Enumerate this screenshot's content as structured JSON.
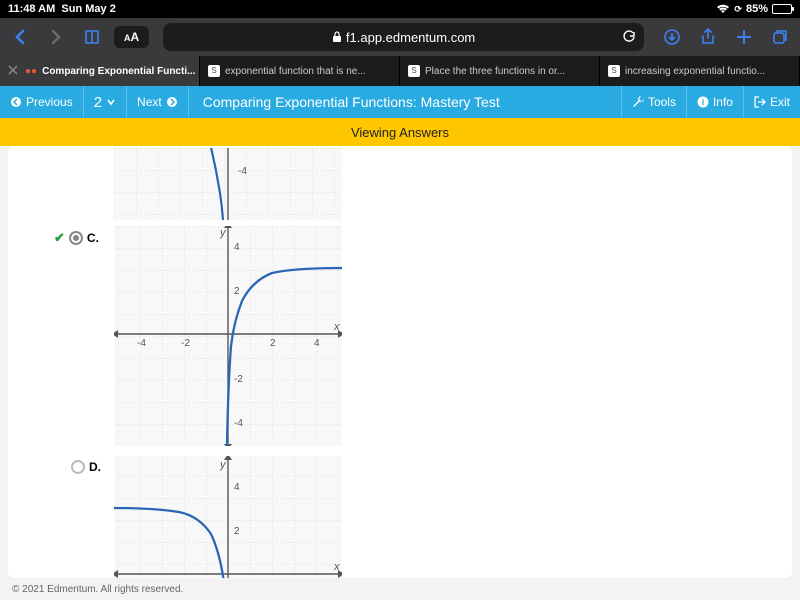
{
  "status": {
    "time": "11:48 AM",
    "date": "Sun May 2",
    "battery": "85%"
  },
  "browser": {
    "url_host": "f1.app.edmentum.com",
    "tabs": [
      {
        "title": "Comparing Exponential Functi..."
      },
      {
        "title": "exponential function that is ne..."
      },
      {
        "title": "Place the three functions in or..."
      },
      {
        "title": "increasing exponential functio..."
      }
    ]
  },
  "appbar": {
    "previous": "Previous",
    "next": "Next",
    "question_number": "2",
    "title": "Comparing Exponential Functions: Mastery Test",
    "tools": "Tools",
    "info": "Info",
    "exit": "Exit"
  },
  "banner": "Viewing Answers",
  "options": {
    "c": {
      "label": "C.",
      "correct": true
    },
    "d": {
      "label": "D.",
      "correct": false
    }
  },
  "chart_data": [
    {
      "type": "line",
      "note": "partial view bottom of option B",
      "xlim": [
        -5,
        5
      ],
      "ylim": [
        -6,
        -3
      ],
      "axis_ticks_y": [
        -4
      ],
      "series": [
        {
          "name": "curve",
          "color": "#1f5eae",
          "points": [
            [
              -0.9,
              -3.2
            ],
            [
              -0.6,
              -4
            ],
            [
              -0.4,
              -5
            ],
            [
              -0.2,
              -6
            ]
          ]
        }
      ]
    },
    {
      "type": "line",
      "title": "",
      "xlabel": "x",
      "ylabel": "y",
      "xlim": [
        -5,
        5
      ],
      "ylim": [
        -6,
        5
      ],
      "axis_ticks_x": [
        -4,
        -2,
        2,
        4
      ],
      "axis_ticks_y": [
        -4,
        -2,
        2,
        4
      ],
      "series": [
        {
          "name": "curve",
          "color": "#1f5eae",
          "points": [
            [
              -0.08,
              -6
            ],
            [
              -0.03,
              -4
            ],
            [
              0.05,
              -2
            ],
            [
              0.15,
              -0.5
            ],
            [
              0.35,
              0.8
            ],
            [
              0.7,
              1.8
            ],
            [
              1.1,
              2.3
            ],
            [
              1.6,
              2.6
            ],
            [
              2.5,
              2.85
            ],
            [
              3.5,
              2.95
            ],
            [
              5,
              3.0
            ]
          ]
        }
      ]
    },
    {
      "type": "line",
      "title": "",
      "xlabel": "x",
      "ylabel": "y",
      "xlim": [
        -5,
        5
      ],
      "ylim": [
        0,
        5
      ],
      "axis_ticks_y": [
        2,
        4
      ],
      "series": [
        {
          "name": "curve",
          "color": "#1f5eae",
          "points": [
            [
              -5,
              3.0
            ],
            [
              -3.5,
              2.95
            ],
            [
              -2.5,
              2.85
            ],
            [
              -1.6,
              2.6
            ],
            [
              -1.1,
              2.3
            ],
            [
              -0.7,
              1.8
            ],
            [
              -0.35,
              0.8
            ],
            [
              -0.15,
              0
            ]
          ]
        }
      ]
    }
  ],
  "footer": "© 2021 Edmentum. All rights reserved."
}
